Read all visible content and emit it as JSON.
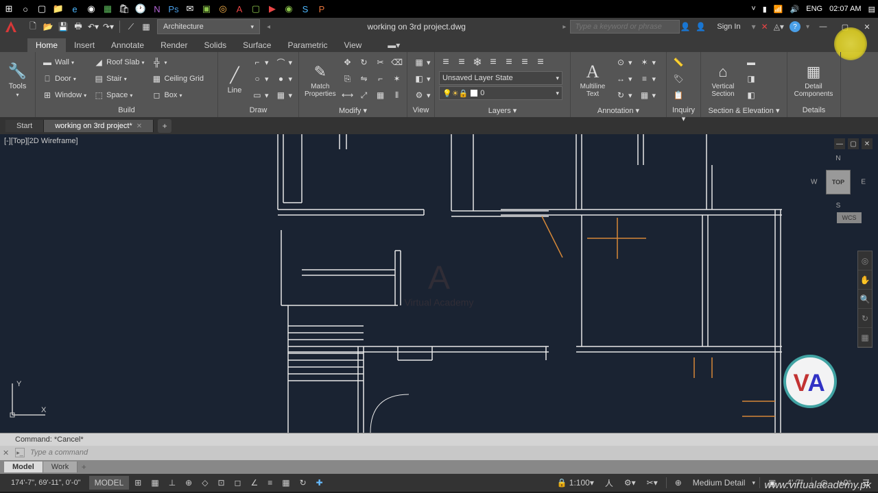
{
  "taskbar": {
    "lang": "ENG",
    "time": "02:07 AM"
  },
  "titlebar": {
    "workspace": "Architecture",
    "title": "working on 3rd project.dwg",
    "search_placeholder": "Type a keyword or phrase",
    "signin": "Sign In"
  },
  "ribbon_tabs": [
    "Home",
    "Insert",
    "Annotate",
    "Render",
    "Solids",
    "Surface",
    "Parametric",
    "View"
  ],
  "ribbon": {
    "tools": {
      "label": "Tools"
    },
    "build": {
      "label": "Build",
      "wall": "Wall",
      "roof": "Roof Slab",
      "door": "Door",
      "stair": "Stair",
      "ceiling": "Ceiling Grid",
      "window": "Window",
      "space": "Space",
      "box": "Box"
    },
    "draw": {
      "label": "Draw",
      "line": "Line"
    },
    "modify": {
      "label": "Modify ▾",
      "match": "Match Properties"
    },
    "view": {
      "label": "View"
    },
    "layers": {
      "label": "Layers ▾",
      "state": "Unsaved Layer State",
      "current": "0"
    },
    "annotation": {
      "label": "Annotation ▾",
      "mtext": "Multiline Text"
    },
    "inquiry": {
      "label": "Inquiry ▾"
    },
    "section": {
      "label": "Section & Elevation ▾",
      "vs": "Vertical Section"
    },
    "details": {
      "label": "Details",
      "dc": "Detail Components"
    }
  },
  "doc_tabs": {
    "start": "Start",
    "file": "working on 3rd project*"
  },
  "viewport": {
    "label": "[-][Top][2D Wireframe]",
    "cube": "TOP",
    "wcs": "WCS",
    "n": "N",
    "s": "S",
    "e": "E",
    "w": "W"
  },
  "command": {
    "history": "Command: *Cancel*",
    "placeholder": "Type a command"
  },
  "layout_tabs": {
    "model": "Model",
    "work": "Work"
  },
  "statusbar": {
    "coords": "174'-7\", 69'-11\", 0'-0\"",
    "model": "MODEL",
    "scale": "1:100",
    "detail": "Medium Detail",
    "elev": "4'-7\"",
    "angle": "+0°"
  },
  "url": "www.virtualacademy.pk"
}
